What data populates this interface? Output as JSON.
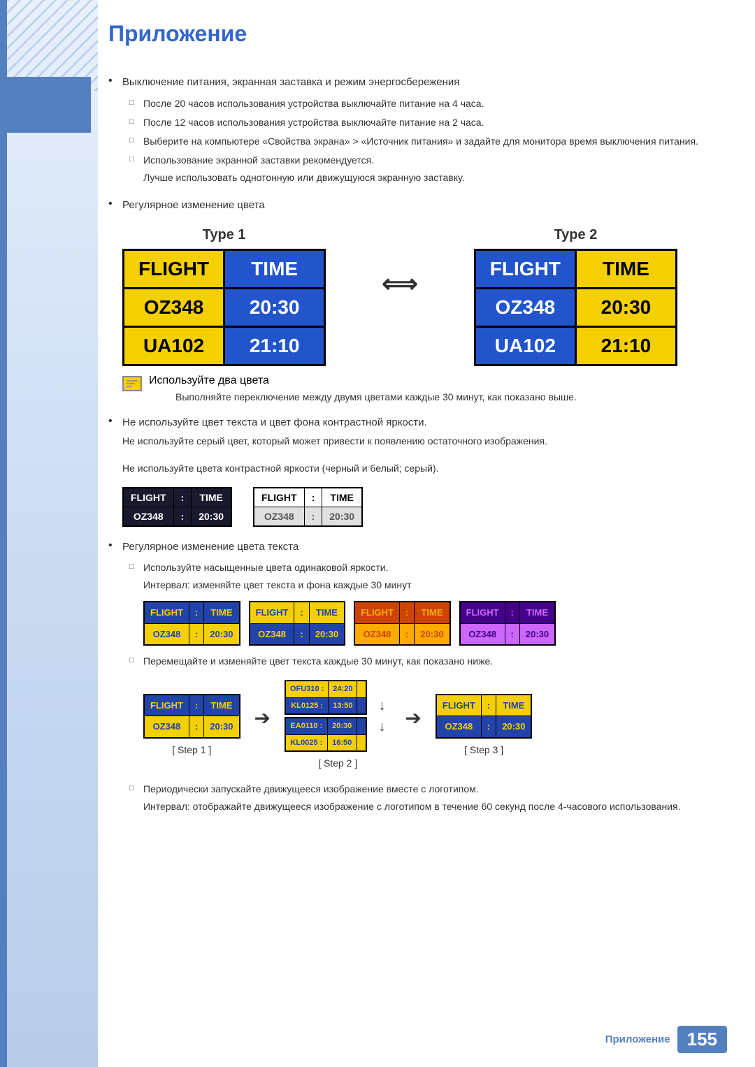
{
  "page": {
    "title": "Приложение"
  },
  "content": {
    "bullet1": {
      "text": "Выключение питания, экранная заставка и режим энергосбережения",
      "sub1": "После 20 часов использования устройства выключайте питание на 4 часа.",
      "sub2": "После 12 часов использования устройства выключайте питание на 2 часа.",
      "sub3": "Выберите на компьютере «Свойства экрана» > «Источник питания» и задайте для монитора время выключения питания.",
      "sub4": "Использование экранной заставки рекомендуется.",
      "sub4extra": "Лучше использовать однотонную или движущуюся экранную заставку."
    },
    "bullet2": {
      "text": "Регулярное изменение цвета",
      "arrow": "⟺",
      "type1": {
        "label": "Type 1",
        "col1header": "FLIGHT",
        "col2header": "TIME",
        "row1col1": "OZ348",
        "row1col2": "20:30",
        "row2col1": "UA102",
        "row2col2": "21:10"
      },
      "type2": {
        "label": "Type 2",
        "col1header": "FLIGHT",
        "col2header": "TIME",
        "row1col1": "OZ348",
        "row1col2": "20:30",
        "row2col1": "UA102",
        "row2col2": "21:10"
      }
    },
    "note1": {
      "title": "Используйте два цвета",
      "body": "Выполняйте переключение между двумя цветами каждые 30 минут, как показано выше."
    },
    "bullet3": {
      "text": "Не используйте цвет текста и цвет фона контрастной яркости.",
      "sub1": "Не используйте серый цвет, который может привести к появлению остаточного изображения.",
      "sub2": "Не используйте цвета контрастной яркости (черный и белый; серый).",
      "board1": {
        "r1c1": "FLIGHT",
        "r1c2": ":",
        "r1c3": "TIME",
        "r2c1": "OZ348",
        "r2c2": ":",
        "r2c3": "20:30"
      },
      "board2": {
        "r1c1": "FLIGHT",
        "r1c2": ":",
        "r1c3": "TIME",
        "r2c1": "OZ348",
        "r2c2": ":",
        "r2c3": "20:30"
      }
    },
    "bullet4": {
      "text": "Регулярное изменение цвета текста",
      "sub1": "Используйте насыщенные цвета одинаковой яркости.",
      "sub1extra": "Интервал: изменяйте цвет текста и фона каждые 30 минут",
      "sub2": "Перемещайте и изменяйте цвет текста каждые 30 минут, как показано ниже.",
      "sub3": "Периодически запускайте движущееся изображение вместе с логотипом.",
      "sub3extra": "Интервал: отображайте движущееся изображение с логотипом в течение 60 секунд после 4-часового использования.",
      "board1": {
        "r1c1": "FLIGHT",
        "r1c2": ":",
        "r1c3": "TIME",
        "r2c1": "OZ348",
        "r2c2": ":",
        "r2c3": "20:30"
      },
      "board2": {
        "r1c1": "FLIGHT",
        "r1c2": ":",
        "r1c3": "TIME",
        "r2c1": "OZ348",
        "r2c2": ":",
        "r2c3": "20:30"
      },
      "board3": {
        "r1c1": "FLIGHT",
        "r1c2": ":",
        "r1c3": "TIME",
        "r2c1": "OZ348",
        "r2c2": ":",
        "r2c3": "20:30"
      },
      "board4": {
        "r1c1": "FLIGHT",
        "r1c2": ":",
        "r1c3": "TIME",
        "r2c1": "OZ348",
        "r2c2": ":",
        "r2c3": "20:30"
      },
      "steps": {
        "step1": {
          "r1c1": "FLIGHT",
          "r1c2": ":",
          "r1c3": "TIME",
          "r2c1": "OZ348",
          "r2c2": ":",
          "r2c3": "20:30",
          "label": "[ Step 1 ]"
        },
        "step2": {
          "top": {
            "r1c1": "OFU310 :",
            "r1c2": "24:20",
            "r1c3": "",
            "r2c1": "KL0125 :",
            "r2c2": "13:50",
            "r2c3": ""
          },
          "bottom": {
            "r1c1": "EA0110 :",
            "r1c2": "20:30",
            "r1c3": "",
            "r2c1": "KL0025 :",
            "r2c2": "16:50",
            "r2c3": ""
          },
          "label": "[ Step 2 ]"
        },
        "step3": {
          "r1c1": "FLIGHT",
          "r1c2": ":",
          "r1c3": "TIME",
          "r2c1": "OZ348",
          "r2c2": ":",
          "r2c3": "20:30",
          "label": "[ Step 3 ]"
        }
      }
    }
  },
  "footer": {
    "label": "Приложение",
    "pagenum": "155"
  }
}
